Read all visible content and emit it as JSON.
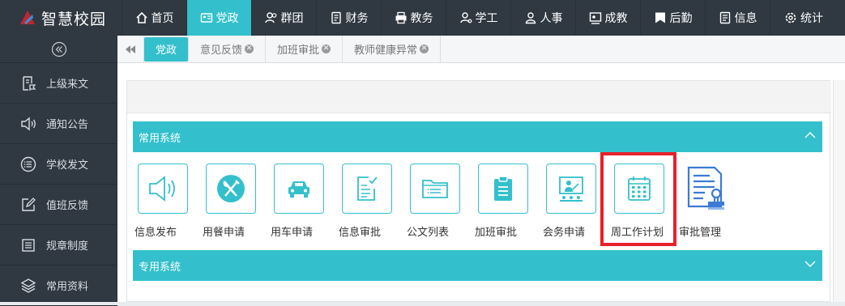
{
  "app": {
    "title": "智慧校园"
  },
  "nav": [
    {
      "label": "首页",
      "icon": "home-icon",
      "active": false
    },
    {
      "label": "党政",
      "icon": "id-card-icon",
      "active": true
    },
    {
      "label": "群团",
      "icon": "group-icon",
      "active": false
    },
    {
      "label": "财务",
      "icon": "finance-icon",
      "active": false
    },
    {
      "label": "教务",
      "icon": "printer-icon",
      "active": false
    },
    {
      "label": "学工",
      "icon": "student-icon",
      "active": false
    },
    {
      "label": "人事",
      "icon": "person-icon",
      "active": false
    },
    {
      "label": "成教",
      "icon": "board-icon",
      "active": false
    },
    {
      "label": "后勤",
      "icon": "flag-icon",
      "active": false
    },
    {
      "label": "信息",
      "icon": "doc-icon",
      "active": false
    },
    {
      "label": "统计",
      "icon": "gear-icon",
      "active": false
    }
  ],
  "sidebar": {
    "items": [
      {
        "label": "上级来文",
        "icon": "file-flag-icon"
      },
      {
        "label": "通知公告",
        "icon": "speaker-icon"
      },
      {
        "label": "学校发文",
        "icon": "list-circle-icon"
      },
      {
        "label": "值班反馈",
        "icon": "edit-icon"
      },
      {
        "label": "规章制度",
        "icon": "list-box-icon"
      },
      {
        "label": "常用资料",
        "icon": "layers-icon"
      }
    ]
  },
  "tabs": [
    {
      "label": "党政",
      "active": true,
      "closable": false
    },
    {
      "label": "意见反馈",
      "active": false,
      "closable": true
    },
    {
      "label": "加班审批",
      "active": false,
      "closable": true
    },
    {
      "label": "教师健康异常",
      "active": false,
      "closable": true
    }
  ],
  "sections": {
    "common": {
      "title": "常用系统"
    },
    "special": {
      "title": "专用系统"
    }
  },
  "apps": [
    {
      "label": "信息发布",
      "icon": "speaker-icon"
    },
    {
      "label": "用餐申请",
      "icon": "utensils-icon"
    },
    {
      "label": "用车申请",
      "icon": "car-icon"
    },
    {
      "label": "信息审批",
      "icon": "doc-check-icon"
    },
    {
      "label": "公文列表",
      "icon": "folder-list-icon"
    },
    {
      "label": "加班审批",
      "icon": "clipboard-icon"
    },
    {
      "label": "会务申请",
      "icon": "meeting-icon"
    },
    {
      "label": "周工作计划",
      "icon": "calendar-icon"
    },
    {
      "label": "审批管理",
      "icon": "approval-stamp-icon"
    }
  ],
  "colors": {
    "accent": "#33c0cc",
    "dark": "#303841",
    "highlight": "#e8202a",
    "approval_blue": "#3b7bd4"
  }
}
